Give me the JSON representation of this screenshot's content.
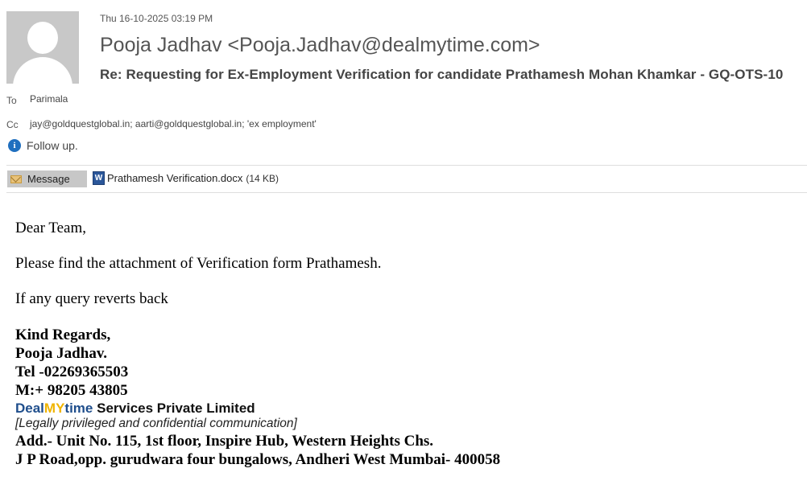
{
  "header": {
    "datetime": "Thu 16-10-2025 03:19 PM",
    "sender": "Pooja Jadhav <Pooja.Jadhav@dealmytime.com>",
    "subject": "Re: Requesting for Ex-Employment Verification for candidate Prathamesh Mohan Khamkar - GQ-OTS-10",
    "to_label": "To",
    "to_value": "Parimala",
    "cc_label": "Cc",
    "cc_value": "jay@goldquestglobal.in; aarti@goldquestglobal.in; 'ex employment'",
    "info_text": "Follow up.",
    "info_icon": "info-icon"
  },
  "tabs": {
    "message_label": "Message",
    "message_icon": "envelope-icon",
    "attachment_name": "Prathamesh Verification.docx",
    "attachment_size": "(14 KB)",
    "attachment_icon": "word-doc-icon"
  },
  "body": {
    "greeting": "Dear Team,",
    "line1": "Please find the attachment of Verification form Prathamesh.",
    "line2": "If any query reverts back",
    "sig_regards": "Kind Regards,",
    "sig_name": "Pooja Jadhav.",
    "sig_tel": "Tel -02269365503",
    "sig_mobile": "M:+ 98205 43805",
    "company_deal": "Deal",
    "company_my": "MY",
    "company_time": "time",
    "company_rest": " Services Private Limited",
    "legal": "[Legally privileged and confidential communication]",
    "address1": "Add.- Unit No. 115, 1st floor, Inspire Hub, Western Heights Chs.",
    "address2": "J P Road,opp. gurudwara four bungalows, Andheri West Mumbai- 400058"
  },
  "colors": {
    "company_blue": "#1f4e8c",
    "company_yellow": "#f0b400",
    "tab_active": "#c7c7c7",
    "word_blue": "#2b579a"
  }
}
